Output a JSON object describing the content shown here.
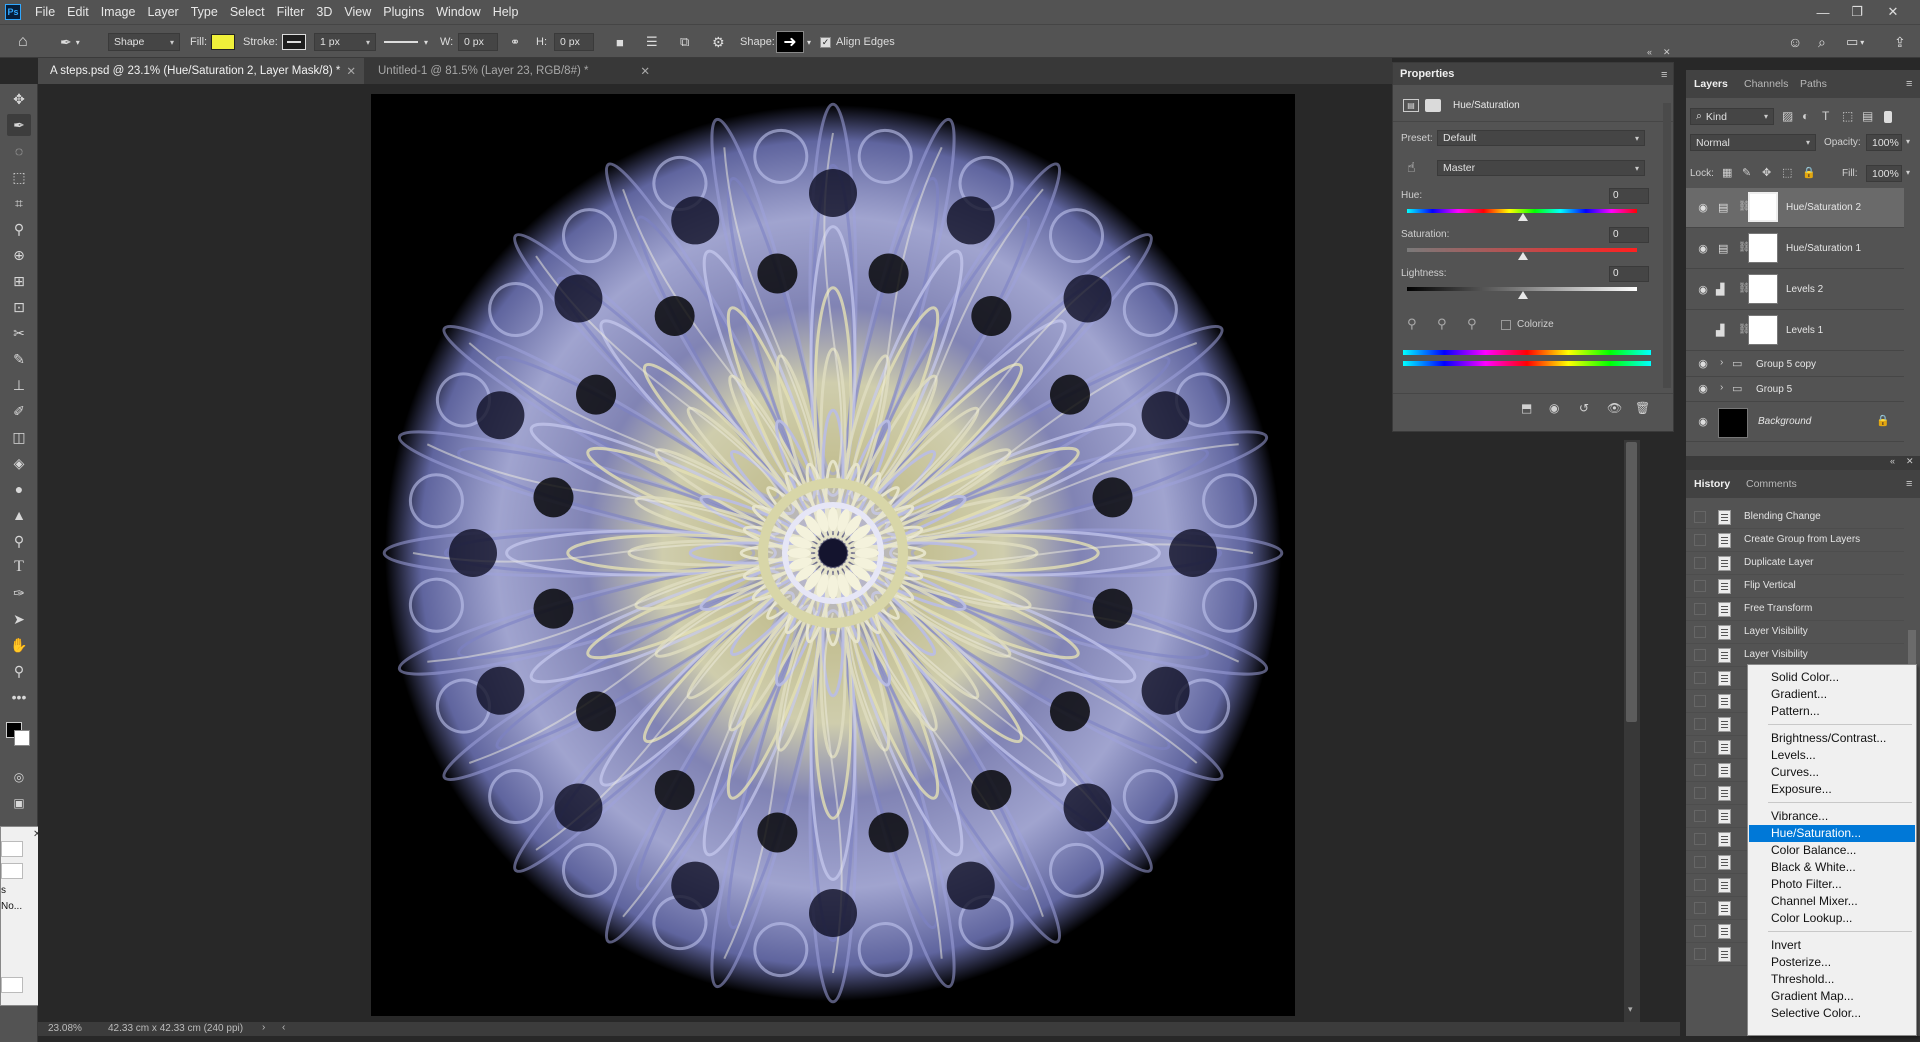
{
  "app": {
    "logo": "Ps"
  },
  "menubar": {
    "items": [
      "File",
      "Edit",
      "Image",
      "Layer",
      "Type",
      "Select",
      "Filter",
      "3D",
      "View",
      "Plugins",
      "Window",
      "Help"
    ]
  },
  "window_controls": {
    "minimize": "—",
    "restore": "❐",
    "close": "✕"
  },
  "options_bar": {
    "mode": "Shape",
    "fill_label": "Fill:",
    "fill_color": "#f0f03a",
    "stroke_label": "Stroke:",
    "stroke_width": "1 px",
    "w_label": "W:",
    "w_value": "0 px",
    "h_label": "H:",
    "h_value": "0 px",
    "shape_label": "Shape:",
    "align_edges": "Align Edges"
  },
  "tabs": [
    {
      "label": "A steps.psd @ 23.1% (Hue/Saturation 2, Layer Mask/8) *",
      "active": true
    },
    {
      "label": "Untitled-1 @ 81.5% (Layer 23, RGB/8#) *",
      "active": false
    }
  ],
  "status": {
    "zoom": "23.08%",
    "doc_size": "42.33 cm x 42.33 cm (240 ppi)"
  },
  "properties": {
    "title": "Properties",
    "adjustment_name": "Hue/Saturation",
    "preset_label": "Preset:",
    "preset_value": "Default",
    "channel_value": "Master",
    "hue_label": "Hue:",
    "hue_value": "0",
    "saturation_label": "Saturation:",
    "saturation_value": "0",
    "lightness_label": "Lightness:",
    "lightness_value": "0",
    "colorize_label": "Colorize"
  },
  "layers_panel": {
    "tabs": [
      "Layers",
      "Channels",
      "Paths"
    ],
    "filter_kind": "Kind",
    "blend_mode": "Normal",
    "opacity_label": "Opacity:",
    "opacity_value": "100%",
    "lock_label": "Lock:",
    "fill_label": "Fill:",
    "fill_value": "100%",
    "layers": [
      {
        "name": "Hue/Saturation 2",
        "visible": true,
        "selected": true
      },
      {
        "name": "Hue/Saturation 1",
        "visible": true
      },
      {
        "name": "Levels 2",
        "visible": true
      },
      {
        "name": "Levels 1",
        "visible": false
      },
      {
        "name": "Group 5 copy",
        "visible": true
      },
      {
        "name": "Group 5",
        "visible": true
      },
      {
        "name": "Background",
        "visible": true
      }
    ]
  },
  "history_panel": {
    "tabs": [
      "History",
      "Comments"
    ],
    "items": [
      "Blending Change",
      "Create Group from Layers",
      "Duplicate Layer",
      "Flip Vertical",
      "Free Transform",
      "Layer Visibility",
      "Layer Visibility"
    ]
  },
  "adjustment_menu": {
    "groups": [
      [
        "Solid Color...",
        "Gradient...",
        "Pattern..."
      ],
      [
        "Brightness/Contrast...",
        "Levels...",
        "Curves...",
        "Exposure..."
      ],
      [
        "Vibrance...",
        "Hue/Saturation...",
        "Color Balance...",
        "Black & White...",
        "Photo Filter...",
        "Channel Mixer...",
        "Color Lookup..."
      ],
      [
        "Invert",
        "Posterize...",
        "Threshold...",
        "Gradient Map...",
        "Selective Color..."
      ]
    ],
    "highlighted": "Hue/Saturation..."
  },
  "left_float": {
    "row1": "s",
    "row2": "No..."
  }
}
